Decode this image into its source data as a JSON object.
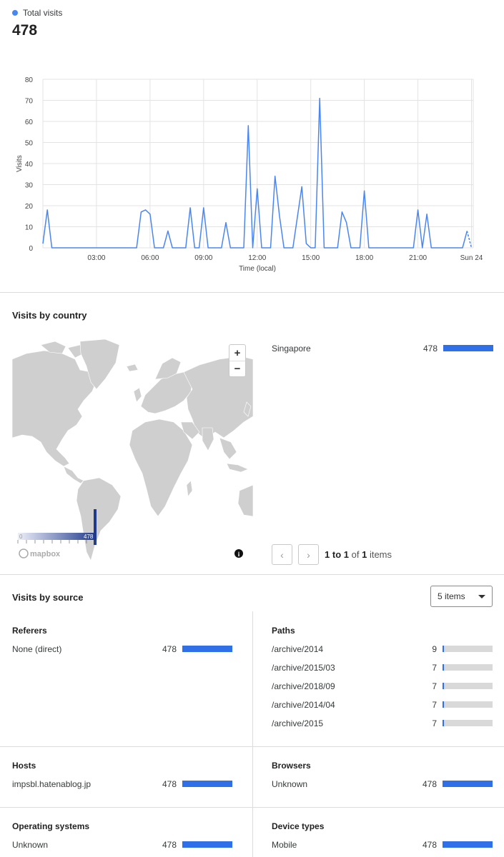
{
  "total": {
    "legend_label": "Total visits",
    "value": "478",
    "accent_color": "#4a86f0"
  },
  "chart_data": {
    "type": "line",
    "ylabel": "Visits",
    "xlabel": "Time (local)",
    "ylim": [
      0,
      80
    ],
    "yticks": [
      0,
      10,
      20,
      30,
      40,
      50,
      60,
      70,
      80
    ],
    "xlim": [
      0,
      24.1
    ],
    "xticks": [
      {
        "at": 3,
        "label": "03:00"
      },
      {
        "at": 6,
        "label": "06:00"
      },
      {
        "at": 9,
        "label": "09:00"
      },
      {
        "at": 12,
        "label": "12:00"
      },
      {
        "at": 15,
        "label": "15:00"
      },
      {
        "at": 18,
        "label": "18:00"
      },
      {
        "at": 21,
        "label": "21:00"
      },
      {
        "at": 24,
        "label": "Sun 24"
      }
    ],
    "grid": true,
    "series": [
      {
        "color": "#4a86f0",
        "points": [
          [
            0.0,
            2
          ],
          [
            0.25,
            18
          ],
          [
            0.5,
            0
          ],
          [
            5.25,
            0
          ],
          [
            5.5,
            17
          ],
          [
            5.75,
            18
          ],
          [
            6.0,
            16
          ],
          [
            6.25,
            0
          ],
          [
            6.75,
            0
          ],
          [
            7.0,
            8
          ],
          [
            7.25,
            0
          ],
          [
            8.0,
            0
          ],
          [
            8.25,
            19
          ],
          [
            8.5,
            0
          ],
          [
            8.75,
            0
          ],
          [
            9.0,
            19
          ],
          [
            9.25,
            0
          ],
          [
            10.0,
            0
          ],
          [
            10.25,
            12
          ],
          [
            10.5,
            0
          ],
          [
            11.25,
            0
          ],
          [
            11.5,
            58
          ],
          [
            11.75,
            0
          ],
          [
            12.0,
            28
          ],
          [
            12.25,
            0
          ],
          [
            12.75,
            0
          ],
          [
            13.0,
            34
          ],
          [
            13.25,
            15
          ],
          [
            13.5,
            0
          ],
          [
            14.0,
            0
          ],
          [
            14.5,
            29
          ],
          [
            14.75,
            2
          ],
          [
            15.0,
            0
          ],
          [
            15.25,
            0
          ],
          [
            15.5,
            71
          ],
          [
            15.75,
            0
          ],
          [
            16.5,
            0
          ],
          [
            16.75,
            17
          ],
          [
            17.0,
            12
          ],
          [
            17.25,
            0
          ],
          [
            17.75,
            0
          ],
          [
            18.0,
            27
          ],
          [
            18.25,
            0
          ],
          [
            20.75,
            0
          ],
          [
            21.0,
            18
          ],
          [
            21.25,
            0
          ],
          [
            21.5,
            16
          ],
          [
            21.75,
            0
          ],
          [
            23.5,
            0
          ],
          [
            23.75,
            8
          ]
        ],
        "dashed_tail": [
          [
            23.75,
            8
          ],
          [
            24.0,
            0
          ]
        ]
      }
    ]
  },
  "country": {
    "title": "Visits by country",
    "rows": [
      {
        "name": "Singapore",
        "count": "478",
        "fraction": 1.0
      }
    ],
    "zoom_in": "+",
    "zoom_out": "−",
    "legend_min": "0",
    "legend_max": "478",
    "map_attribution": "mapbox",
    "info_glyph": "i",
    "pager": {
      "prev": "‹",
      "next": "›",
      "from": "1",
      "to_word": "to",
      "to": "1",
      "of_word": "of",
      "total": "1",
      "items_word": "items"
    }
  },
  "source": {
    "title": "Visits by source",
    "select_value": "5 items",
    "referers": {
      "title": "Referers",
      "rows": [
        {
          "label": "None (direct)",
          "count": "478",
          "fraction": 1.0
        }
      ]
    },
    "paths": {
      "title": "Paths",
      "rows": [
        {
          "label": "/archive/2014",
          "count": "9",
          "fraction": 0.019
        },
        {
          "label": "/archive/2015/03",
          "count": "7",
          "fraction": 0.015
        },
        {
          "label": "/archive/2018/09",
          "count": "7",
          "fraction": 0.015
        },
        {
          "label": "/archive/2014/04",
          "count": "7",
          "fraction": 0.015
        },
        {
          "label": "/archive/2015",
          "count": "7",
          "fraction": 0.015
        }
      ]
    },
    "hosts": {
      "title": "Hosts",
      "rows": [
        {
          "label": "impsbl.hatenablog.jp",
          "count": "478",
          "fraction": 1.0
        }
      ]
    },
    "browsers": {
      "title": "Browsers",
      "rows": [
        {
          "label": "Unknown",
          "count": "478",
          "fraction": 1.0
        }
      ]
    },
    "os": {
      "title": "Operating systems",
      "rows": [
        {
          "label": "Unknown",
          "count": "478",
          "fraction": 1.0
        }
      ]
    },
    "devices": {
      "title": "Device types",
      "rows": [
        {
          "label": "Mobile",
          "count": "478",
          "fraction": 1.0
        }
      ]
    }
  }
}
